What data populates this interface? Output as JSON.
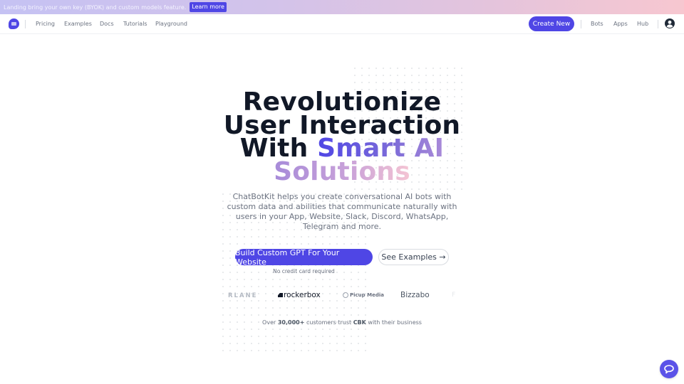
{
  "banner": {
    "message": "Landing bring your own key (BYOK) and custom models feature.",
    "link_label": "Learn more"
  },
  "nav": {
    "left_links": [
      "Pricing",
      "Examples",
      "Docs",
      "Tutorials",
      "Playground"
    ],
    "create_label": "Create New",
    "right_links": [
      "Bots",
      "Apps",
      "Hub"
    ]
  },
  "hero": {
    "title_line1": "Revolutionize",
    "title_line2": "User Interaction",
    "title_line3_plain": "With ",
    "title_line3_accent": "Smart AI",
    "title_line4_accent": "Solutions",
    "description": "ChatBotKit helps you create conversational AI bots with custom data and abilities that communicate naturally with users in your App, Website, Slack, Discord, WhatsApp, Telegram and more.",
    "primary_cta": "Build Custom GPT For Your Website",
    "secondary_cta": "See Examples →",
    "note": "No credit card required"
  },
  "logos": {
    "brands": [
      "RLANE",
      "rockerbox",
      "Picup Media",
      "Bizzabo",
      "F"
    ]
  },
  "trust": {
    "prefix": "Over ",
    "count": "30,000+",
    "middle": " customers trust ",
    "brand": "CBK",
    "suffix": " with their business"
  },
  "colors": {
    "accent": "#4f46e5",
    "text_dark": "#111827",
    "text_muted": "#6b7280"
  }
}
